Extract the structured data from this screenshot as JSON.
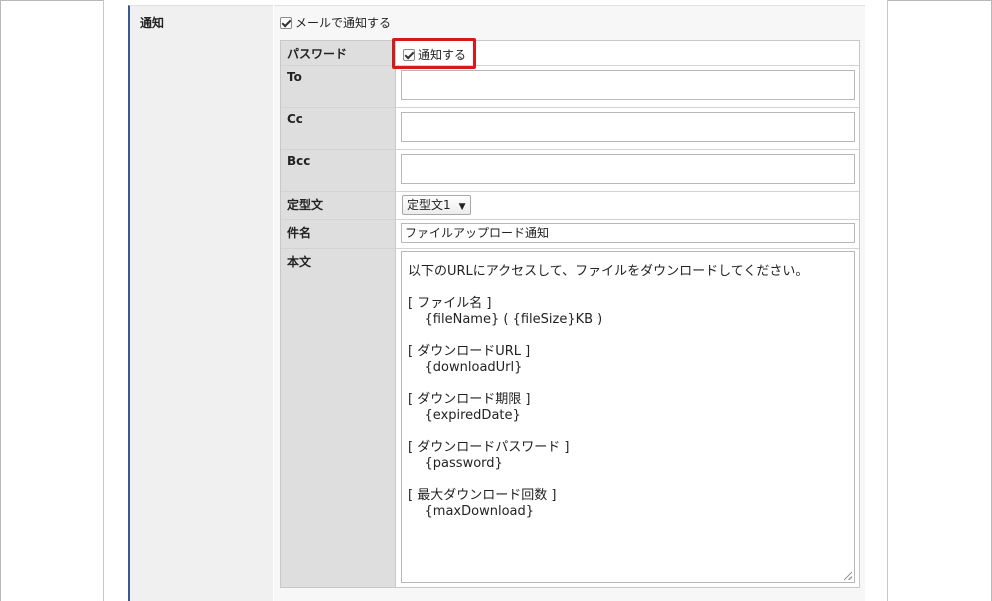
{
  "section": {
    "label": "通知"
  },
  "mail_notify": {
    "label": "メールで通知する",
    "checked": true
  },
  "fields": {
    "password": {
      "label": "パスワード",
      "notify_label": "通知する",
      "checked": true
    },
    "to": {
      "label": "To",
      "value": ""
    },
    "cc": {
      "label": "Cc",
      "value": ""
    },
    "bcc": {
      "label": "Bcc",
      "value": ""
    },
    "template": {
      "label": "定型文",
      "selected": "定型文1"
    },
    "subject": {
      "label": "件名",
      "value": "ファイルアップロード通知"
    },
    "body": {
      "label": "本文",
      "value": "以下のURLにアクセスして、ファイルをダウンロードしてください。\n\n[ ファイル名 ]\n    {fileName} ( {fileSize}KB )\n\n[ ダウンロードURL ]\n    {downloadUrl}\n\n[ ダウンロード期限 ]\n    {expiredDate}\n\n[ ダウンロードパスワード ]\n    {password}\n\n[ 最大ダウンロード回数 ]\n    {maxDownload}"
    }
  },
  "colors": {
    "highlight": "#d41a1a",
    "section_border": "#3a5a8c"
  }
}
